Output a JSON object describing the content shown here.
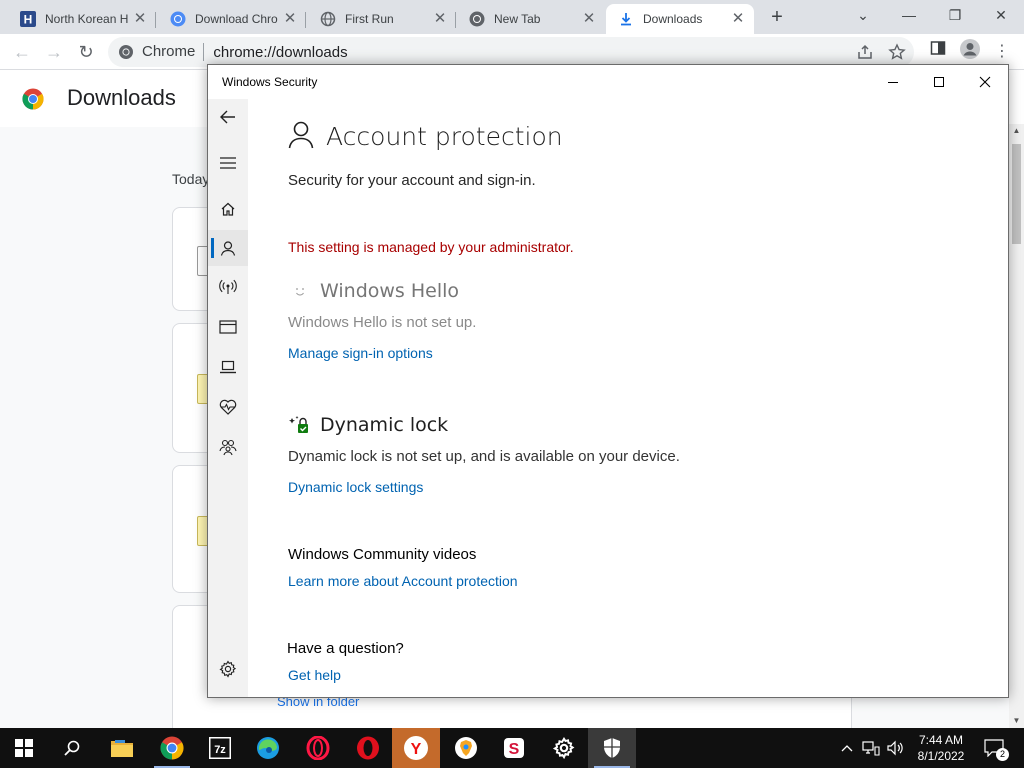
{
  "browser": {
    "tabs": [
      {
        "title": "North Korean H",
        "icon": "h-letter-icon",
        "active": false
      },
      {
        "title": "Download Chro",
        "icon": "chrome-icon",
        "active": false
      },
      {
        "title": "First Run",
        "icon": "globe-icon",
        "active": false
      },
      {
        "title": "New Tab",
        "icon": "chrome-icon",
        "active": false
      },
      {
        "title": "Downloads",
        "icon": "download-icon",
        "active": true
      }
    ],
    "omnibox": {
      "chip": "Chrome",
      "url": "chrome://downloads"
    }
  },
  "downloads_page": {
    "title": "Downloads",
    "date_group": "Today",
    "show_in_folder": "Show in folder"
  },
  "security_window": {
    "title": "Windows Security",
    "page_title": "Account protection",
    "page_subtitle": "Security for your account and sign-in.",
    "admin_notice": "This setting is managed by your administrator.",
    "windows_hello": {
      "title": "Windows Hello",
      "text": "Windows Hello is not set up.",
      "link": "Manage sign-in options"
    },
    "dynamic_lock": {
      "title": "Dynamic lock",
      "text": "Dynamic lock is not set up, and is available on your device.",
      "link": "Dynamic lock settings"
    },
    "community": {
      "title": "Windows Community videos",
      "link": "Learn more about Account protection"
    },
    "question": {
      "title": "Have a question?",
      "link": "Get help"
    },
    "colors": {
      "admin_red": "#a80000",
      "link_blue": "#0063b1",
      "accent": "#0067c0"
    }
  },
  "taskbar": {
    "apps": [
      "file-explorer",
      "chrome",
      "7zip",
      "edge",
      "opera",
      "opera",
      "yandex",
      "brave",
      "app-s",
      "settings",
      "windows-security"
    ],
    "clock": {
      "time": "7:44 AM",
      "date": "8/1/2022"
    },
    "notification_count": "2"
  }
}
